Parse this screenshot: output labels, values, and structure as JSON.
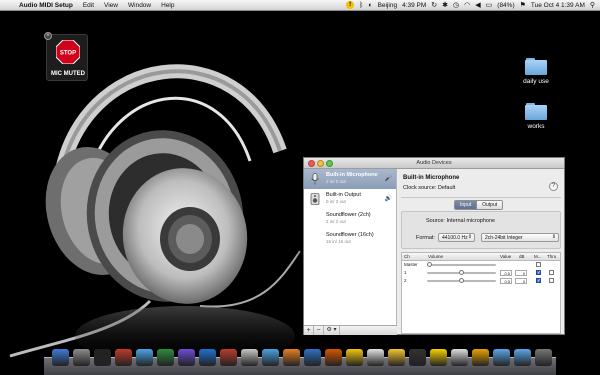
{
  "menubar": {
    "app_name": "Audio MIDI Setup",
    "menus": [
      "Edit",
      "View",
      "Window",
      "Help"
    ],
    "clock_city": "Beijing",
    "city_time": "4:39 PM",
    "battery": "(84%)",
    "datetime": "Tue Oct 4  1:39 AM"
  },
  "mic_widget": {
    "stop_text": "STOP",
    "label": "MIC MUTED"
  },
  "desktop_folders": [
    {
      "label": "daily use"
    },
    {
      "label": "works"
    }
  ],
  "window": {
    "title": "Audio Devices",
    "devices": [
      {
        "name": "Built-in Microphone",
        "io": "2 in/ 0 out",
        "icon": "microphone-icon",
        "selected": true
      },
      {
        "name": "Built-in Output",
        "io": "0 in/ 2 out",
        "icon": "speaker-icon",
        "selected": false
      },
      {
        "name": "Soundflower (2ch)",
        "io": "2 in/ 2 out",
        "icon": "",
        "selected": false
      },
      {
        "name": "Soundflower (16ch)",
        "io": "16 in/ 16 out",
        "icon": "",
        "selected": false
      }
    ],
    "footer": {
      "add": "+",
      "remove": "−",
      "gear": "⚙ ▾"
    },
    "detail": {
      "device_name": "Built-in Microphone",
      "clock_source": "Clock source:  Default",
      "help": "?",
      "tabs": [
        "Input",
        "Output"
      ],
      "active_tab": "Input",
      "source": "Source:  Internal microphone",
      "format_label": "Format:",
      "sample_rate": "44100.0 Hz",
      "bit_format": "2ch-24bit Integer",
      "columns": [
        "Ch",
        "Volume",
        "Value",
        "dB",
        "M...",
        "Thru"
      ],
      "channels": [
        {
          "ch": "Master",
          "value": "",
          "db": "",
          "level": 0.0,
          "mute": false
        },
        {
          "ch": "1",
          "value": "0.5",
          "db": "0",
          "level": 0.5,
          "mute": true
        },
        {
          "ch": "2",
          "value": "0.5",
          "db": "0",
          "level": 0.5,
          "mute": true
        }
      ]
    }
  },
  "dock": {
    "icon_colors": [
      "#3d7bd9",
      "#8c8c8c",
      "#222",
      "#c0392b",
      "#4ca3e6",
      "#2d8a3e",
      "#6f4ad6",
      "#1e6fd0",
      "#b93c2c",
      "#c7c7c7",
      "#4aa1e0",
      "#e67e22",
      "#2f6fc2",
      "#d35400",
      "#f1c40f",
      "#e0e0e0",
      "#f4c430",
      "#333",
      "#f6d000",
      "#ddd",
      "#e8a200",
      "#5aa6e8",
      "#5aa6e8",
      "#777"
    ]
  }
}
